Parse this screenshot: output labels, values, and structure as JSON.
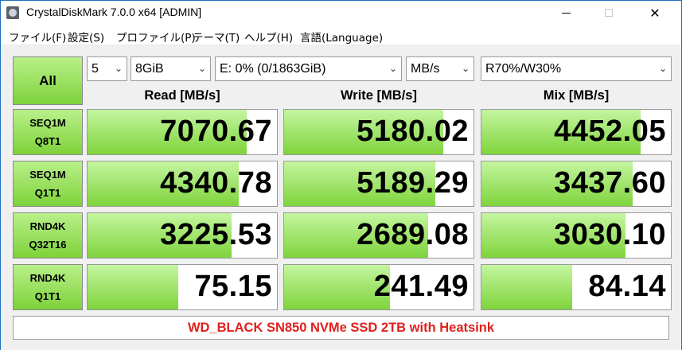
{
  "window": {
    "title": "CrystalDiskMark 7.0.0 x64 [ADMIN]",
    "minimize_glyph": "",
    "close_glyph": "✕"
  },
  "menu": [
    {
      "label": "ファイル(F)"
    },
    {
      "label": "設定(S)"
    },
    {
      "label": "プロファイル(P)"
    },
    {
      "label": "テーマ(T)"
    },
    {
      "label": "ヘルプ(H)"
    },
    {
      "label": "言語(Language)"
    }
  ],
  "controls": {
    "all_button": "All",
    "count": "5",
    "size": "8GiB",
    "drive": "E: 0% (0/1863GiB)",
    "unit": "MB/s",
    "mix": "R70%/W30%",
    "chevron_icon": "chevron-down-icon"
  },
  "headers": {
    "read": "Read [MB/s]",
    "write": "Write [MB/s]",
    "mix": "Mix [MB/s]"
  },
  "rows": [
    {
      "label1": "SEQ1M",
      "label2": "Q8T1",
      "read": "7070.67",
      "write": "5180.02",
      "mix": "4452.05",
      "read_fill": 0.84,
      "write_fill": 0.84,
      "mix_fill": 0.84
    },
    {
      "label1": "SEQ1M",
      "label2": "Q1T1",
      "read": "4340.78",
      "write": "5189.29",
      "mix": "3437.60",
      "read_fill": 0.8,
      "write_fill": 0.8,
      "mix_fill": 0.8
    },
    {
      "label1": "RND4K",
      "label2": "Q32T16",
      "read": "3225.53",
      "write": "2689.08",
      "mix": "3030.10",
      "read_fill": 0.76,
      "write_fill": 0.76,
      "mix_fill": 0.76
    },
    {
      "label1": "RND4K",
      "label2": "Q1T1",
      "read": "75.15",
      "write": "241.49",
      "mix": "84.14",
      "read_fill": 0.48,
      "write_fill": 0.56,
      "mix_fill": 0.48
    }
  ],
  "comment": "WD_BLACK SN850 NVMe SSD 2TB with Heatsink",
  "colors": {
    "accent_green": "#7ed23a",
    "comment_red": "#e0201c"
  }
}
